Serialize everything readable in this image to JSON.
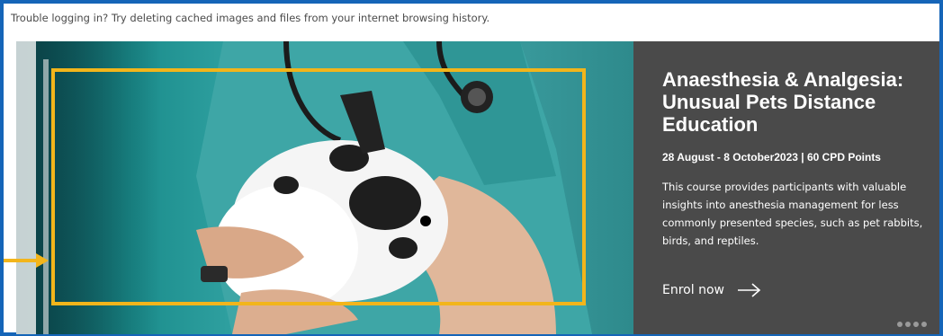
{
  "notice": {
    "text": "Trouble logging in? Try deleting cached images and files from your internet browsing history."
  },
  "course": {
    "title": "Anaesthesia & Analgesia: Unusual Pets Distance Education",
    "dates": "28 August - 8 October2023 | 60 CPD Points",
    "description": "This course provides participants with valuable insights into anesthesia management for less commonly presented species, such as pet rabbits, birds, and reptiles.",
    "enrol_label": "Enrol now",
    "enrol_icon": "arrow-right-icon"
  },
  "carousel": {
    "slide_count": 4,
    "dot_color": "#9a9a9a"
  },
  "colors": {
    "frame_border": "#1565b8",
    "panel_background": "#4a4a4a",
    "highlight": "#f2b51b",
    "scrub_teal": "#2fa0a0"
  }
}
